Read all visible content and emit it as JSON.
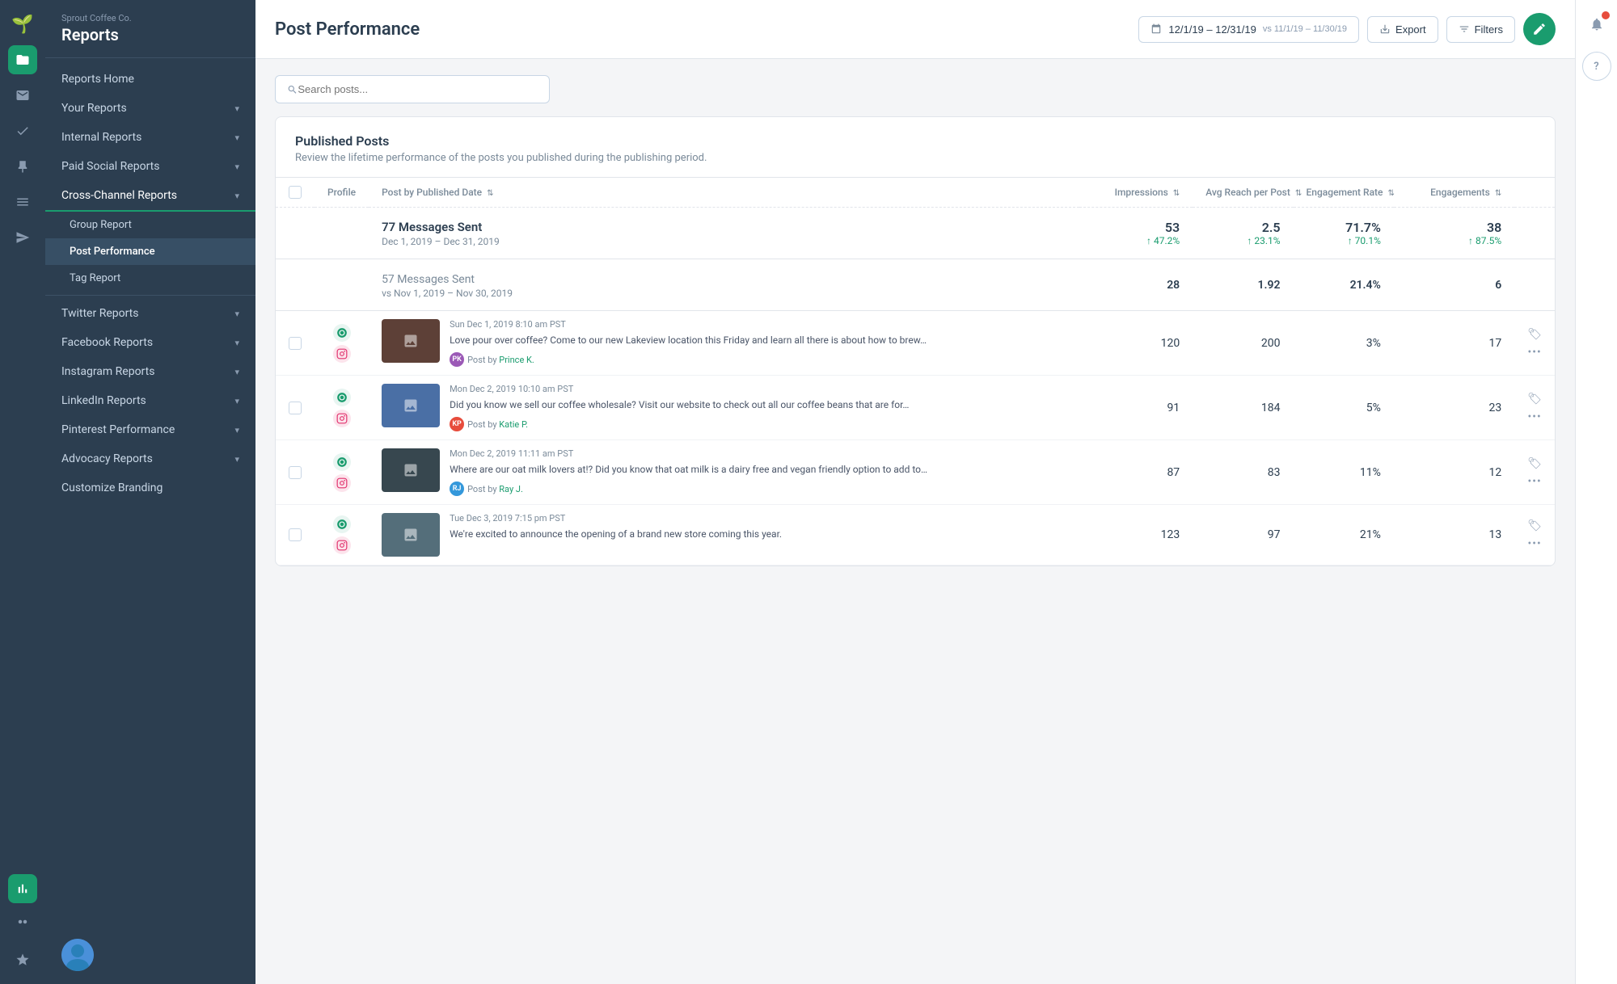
{
  "brand": {
    "company": "Sprout Coffee Co.",
    "app": "Reports"
  },
  "header": {
    "title": "Post Performance",
    "date_range": "12/1/19 – 12/31/19",
    "vs_date": "vs 11/1/19 – 11/30/19",
    "export_label": "Export",
    "filters_label": "Filters"
  },
  "search": {
    "placeholder": "Search posts..."
  },
  "published_posts": {
    "title": "Published Posts",
    "description": "Review the lifetime performance of the posts you published during the publishing period."
  },
  "columns": {
    "profile": "Profile",
    "post_by_date": "Post by Published Date",
    "impressions": "Impressions",
    "avg_reach": "Avg Reach per Post",
    "engagement_rate": "Engagement Rate",
    "engagements": "Engagements"
  },
  "summary_rows": [
    {
      "label": "77 Messages Sent",
      "date_range": "Dec 1, 2019 – Dec 31, 2019",
      "impressions": "53",
      "impressions_change": "↑ 47.2%",
      "avg_reach": "2.5",
      "avg_reach_change": "↑ 23.1%",
      "engagement_rate": "71.7%",
      "engagement_rate_change": "↑ 70.1%",
      "engagements": "38",
      "engagements_change": "↑ 87.5%",
      "change_direction": "up"
    },
    {
      "label": "57 Messages Sent",
      "date_range": "vs Nov 1, 2019 – Nov 30, 2019",
      "impressions": "28",
      "impressions_change": "",
      "avg_reach": "1.92",
      "avg_reach_change": "",
      "engagement_rate": "21.4%",
      "engagement_rate_change": "",
      "engagements": "6",
      "engagements_change": "",
      "change_direction": "neutral"
    }
  ],
  "posts": [
    {
      "date": "Sun Dec 1, 2019 8:10 am PST",
      "text": "Love pour over coffee? Come to our new Lakeview location this Friday and learn all there is about how to brew…",
      "author": "Prince K.",
      "author_type": "Post",
      "impressions": "120",
      "avg_reach": "200",
      "engagement_rate": "3%",
      "engagements": "17",
      "author_color": "#9b59b6"
    },
    {
      "date": "Mon Dec 2, 2019 10:10 am PST",
      "text": "Did you know we sell our coffee wholesale? Visit our website to check out all our coffee beans that are for…",
      "author": "Katie P.",
      "author_type": "Post",
      "impressions": "91",
      "avg_reach": "184",
      "engagement_rate": "5%",
      "engagements": "23",
      "author_color": "#e74c3c"
    },
    {
      "date": "Mon Dec 2, 2019 11:11 am PST",
      "text": "Where are our oat milk lovers at!? Did you know that oat milk is a dairy free and vegan friendly option to add to…",
      "author": "Ray J.",
      "author_type": "Post",
      "impressions": "87",
      "avg_reach": "83",
      "engagement_rate": "11%",
      "engagements": "12",
      "author_color": "#3498db"
    },
    {
      "date": "Tue Dec 3, 2019 7:15 pm PST",
      "text": "We're excited to announce the opening of a brand new store coming this year.",
      "author": "",
      "author_type": "Post",
      "impressions": "123",
      "avg_reach": "97",
      "engagement_rate": "21%",
      "engagements": "13",
      "author_color": "#27ae60"
    }
  ],
  "sidebar": {
    "items": [
      {
        "label": "Reports Home",
        "active": false,
        "expandable": false
      },
      {
        "label": "Your Reports",
        "active": false,
        "expandable": true
      },
      {
        "label": "Internal Reports",
        "active": false,
        "expandable": true
      },
      {
        "label": "Paid Social Reports",
        "active": false,
        "expandable": true
      },
      {
        "label": "Cross-Channel Reports",
        "active": true,
        "expandable": true
      },
      {
        "label": "Twitter Reports",
        "active": false,
        "expandable": true
      },
      {
        "label": "Facebook Reports",
        "active": false,
        "expandable": true
      },
      {
        "label": "Instagram Reports",
        "active": false,
        "expandable": true
      },
      {
        "label": "LinkedIn Reports",
        "active": false,
        "expandable": true
      },
      {
        "label": "Pinterest Performance",
        "active": false,
        "expandable": true
      },
      {
        "label": "Advocacy Reports",
        "active": false,
        "expandable": true
      },
      {
        "label": "Customize Branding",
        "active": false,
        "expandable": false
      }
    ],
    "sub_items": [
      {
        "label": "Group Report"
      },
      {
        "label": "Post Performance",
        "active": true
      },
      {
        "label": "Tag Report"
      }
    ]
  },
  "icons": {
    "calendar": "📅",
    "export": "↑",
    "filter": "⚙",
    "compose": "✎",
    "search": "🔍",
    "bell": "🔔",
    "help": "?",
    "folder": "📁",
    "inbox": "✉",
    "tasks": "✓",
    "pin": "📌",
    "chart": "📊",
    "schedule": "📅",
    "star": "★",
    "tag": "🏷",
    "dots": "•••",
    "sprout": "🌱",
    "instagram": "📸"
  }
}
